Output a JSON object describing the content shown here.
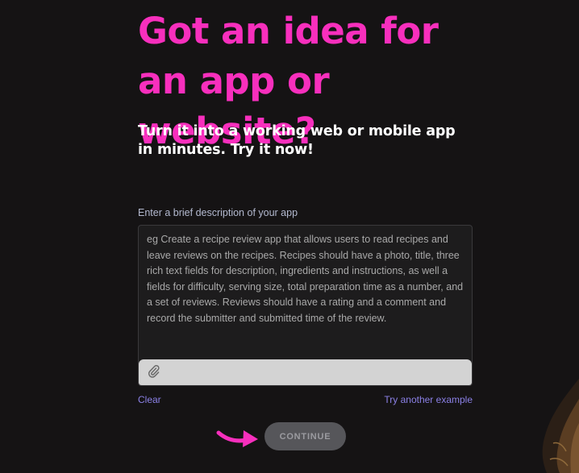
{
  "hero": {
    "title": "Got an idea for an app or website?",
    "subtitle": "Turn it into a working web or mobile app in minutes. Try it now!"
  },
  "form": {
    "label": "Enter a brief description of your app",
    "description_value": "",
    "description_placeholder": "eg Create a recipe review app that allows users to read recipes and leave reviews on the recipes. Recipes should have a photo, title, three rich text fields for description, ingredients and instructions, as well a fields for difficulty, serving size, total preparation time as a number, and a set of reviews. Reviews should have a rating and a comment and record the submitter and submitted time of the review.",
    "clear_label": "Clear",
    "example_label": "Try another example",
    "continue_label": "CONTINUE"
  },
  "icons": {
    "attach": "paperclip-icon",
    "pointer": "arrow-right-icon"
  },
  "colors": {
    "background": "#151314",
    "title": "#f72fbd",
    "link": "#8b80e6",
    "button_bg": "#56565a",
    "button_text": "#9b9ba0"
  }
}
